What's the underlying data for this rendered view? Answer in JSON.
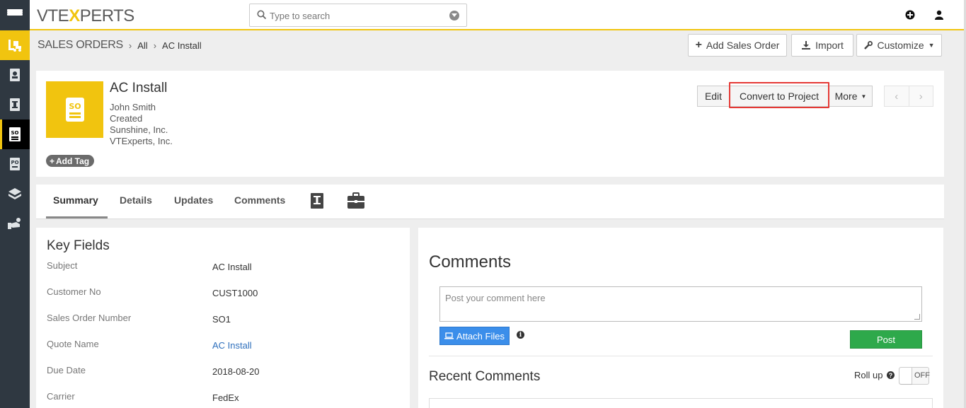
{
  "app": {
    "logo_left": "VTE",
    "logo_x": "X",
    "logo_right": "PERTS"
  },
  "search": {
    "placeholder": "Type to search"
  },
  "breadcrumb": {
    "module": "SALES ORDERS",
    "filter": "All",
    "record": "AC Install"
  },
  "toolbar": {
    "add_label": "Add Sales Order",
    "import_label": "Import",
    "customize_label": "Customize"
  },
  "record": {
    "avatar_text": "SO",
    "title": "AC Install",
    "lines": [
      "John Smith",
      "Created",
      "Sunshine, Inc.",
      "VTExperts, Inc."
    ],
    "add_tag": "Add Tag",
    "edit_label": "Edit",
    "convert_label": "Convert to Project",
    "more_label": "More"
  },
  "tabs": [
    "Summary",
    "Details",
    "Updates",
    "Comments"
  ],
  "key_fields": {
    "title": "Key Fields",
    "rows": [
      {
        "label": "Subject",
        "value": "AC Install"
      },
      {
        "label": "Customer No",
        "value": "CUST1000"
      },
      {
        "label": "Sales Order Number",
        "value": "SO1"
      },
      {
        "label": "Quote Name",
        "value": "AC Install"
      },
      {
        "label": "Due Date",
        "value": "2018-08-20"
      },
      {
        "label": "Carrier",
        "value": "FedEx"
      }
    ]
  },
  "comments": {
    "title": "Comments",
    "placeholder": "Post your comment here",
    "attach_label": "Attach Files",
    "post_label": "Post",
    "recent_title": "Recent Comments",
    "rollup_label": "Roll up",
    "toggle_label": "OFF"
  },
  "colors": {
    "accent": "#f1c40f",
    "rail": "#2f3841",
    "post": "#2ea94b",
    "attach": "#3b8eea",
    "highlight": "#e53935"
  }
}
